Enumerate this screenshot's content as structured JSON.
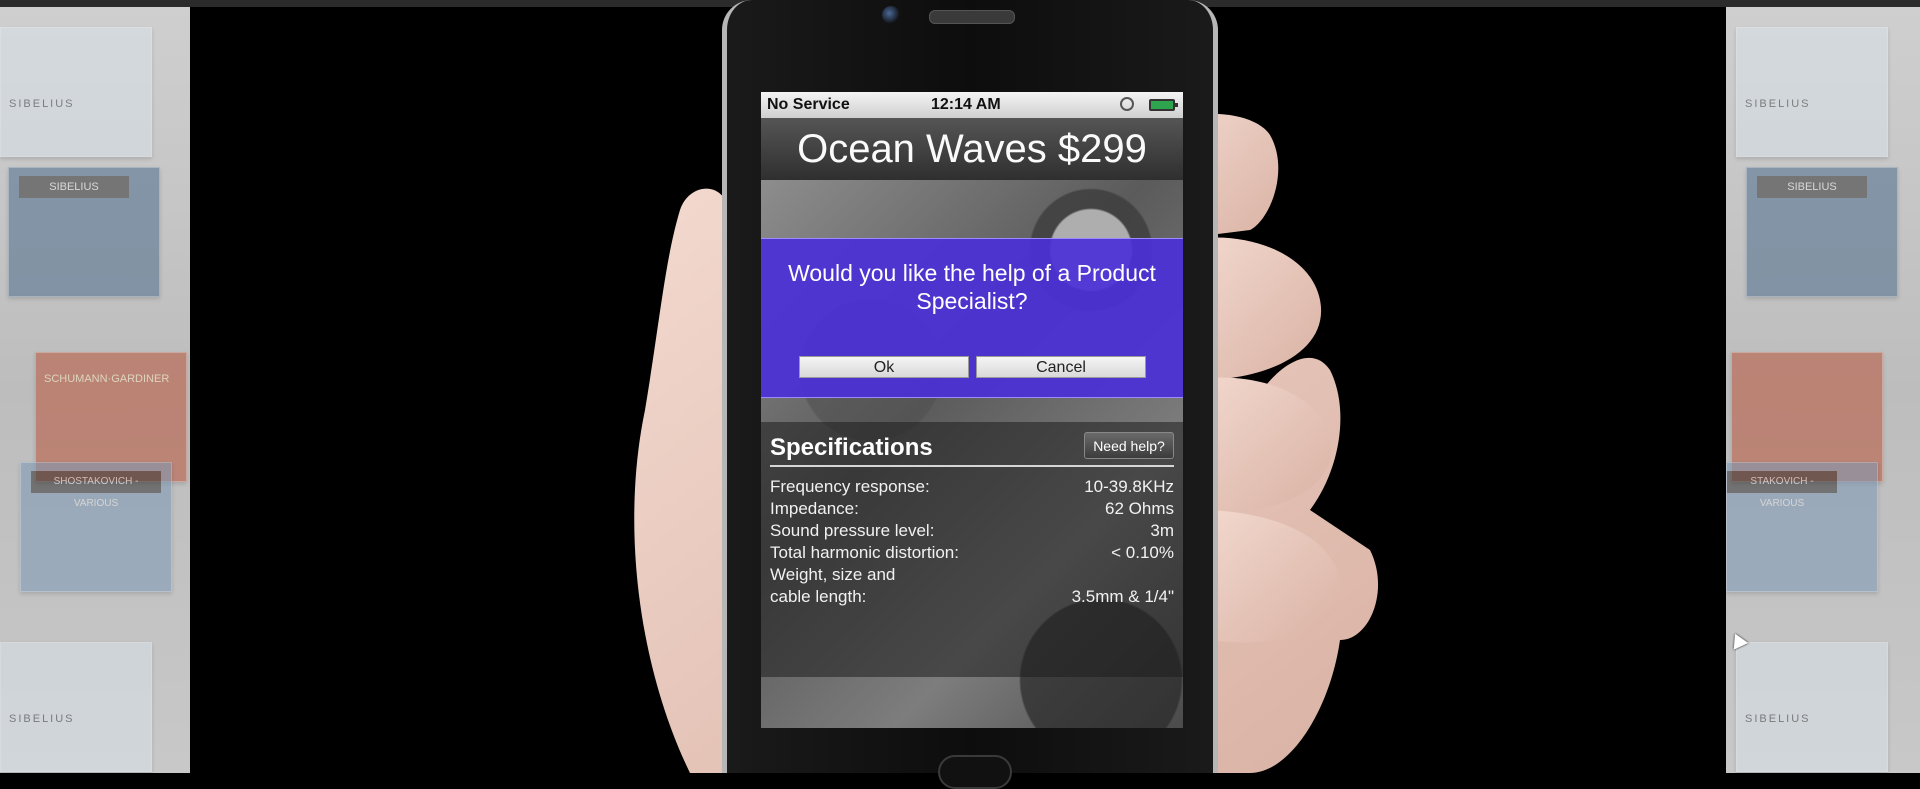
{
  "shelves": {
    "left_cds": [
      "SIBELIUS",
      "SCHUMANN·GARDINER",
      "SHOSTAKOVICH - VARIOUS",
      "SHOSTAKOVICH",
      "SIBELIUS"
    ],
    "right_cds": [
      "SIBELIUS",
      "SIBELIUS",
      "STAKOVICH - VARIOUS",
      "STAKOVICH",
      "SIBELIUS"
    ]
  },
  "status_bar": {
    "carrier": "No Service",
    "time": "12:14 AM",
    "lock_icon": "rotation-lock-icon",
    "battery_icon": "battery-icon"
  },
  "product": {
    "title": "Ocean Waves $299"
  },
  "dialog": {
    "message": "Would you like the help of a Product Specialist?",
    "ok_label": "Ok",
    "cancel_label": "Cancel"
  },
  "specs": {
    "title": "Specifications",
    "help_button": "Need help?",
    "rows": [
      {
        "label": "Frequency response:",
        "value": "10-39.8KHz"
      },
      {
        "label": "Impedance:",
        "value": "62 Ohms"
      },
      {
        "label": "Sound pressure level:",
        "value": "3m"
      },
      {
        "label": "Total harmonic distortion:",
        "value": "< 0.10%"
      },
      {
        "label": "Weight, size and",
        "label2": "cable length:",
        "value": "3.5mm & 1/4\""
      }
    ]
  },
  "colors": {
    "dialog_bg": "#4c30d7",
    "status_bar_bg": "#e6e6e6",
    "battery_fill": "#2ea44f"
  }
}
